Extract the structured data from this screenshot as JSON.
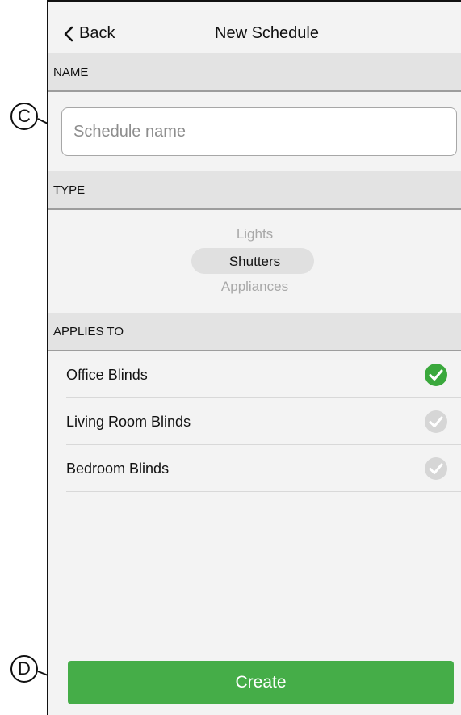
{
  "nav": {
    "back_label": "Back",
    "title": "New Schedule"
  },
  "sections": {
    "name": "NAME",
    "type": "TYPE",
    "applies_to": "APPLIES TO"
  },
  "name_input": {
    "placeholder": "Schedule name",
    "value": ""
  },
  "type_picker": {
    "options": [
      "Lights",
      "Shutters",
      "Appliances"
    ],
    "selected": "Shutters"
  },
  "applies_to": [
    {
      "label": "Office Blinds",
      "checked": true
    },
    {
      "label": "Living Room Blinds",
      "checked": false
    },
    {
      "label": "Bedroom Blinds",
      "checked": false
    }
  ],
  "create_label": "Create",
  "callouts": {
    "c": "C",
    "d": "D"
  },
  "colors": {
    "accent": "#45ad48",
    "check_on": "#3aa83c",
    "check_off": "#d6d6d6"
  }
}
